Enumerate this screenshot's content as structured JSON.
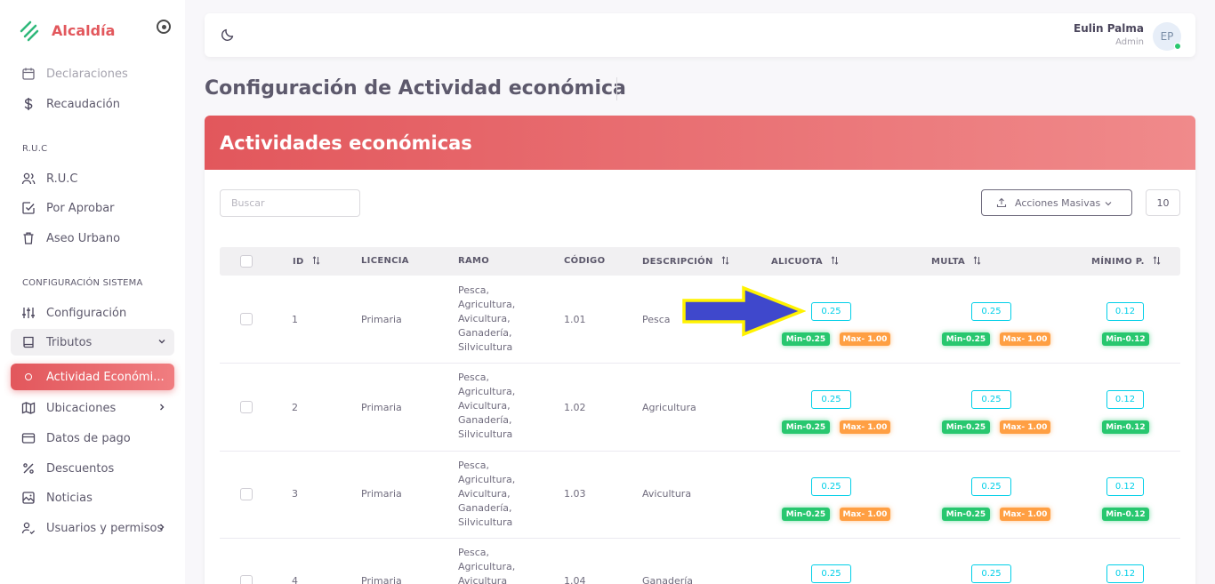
{
  "brand": {
    "name": "Alcaldía"
  },
  "sidebar": {
    "items_top": [
      {
        "label": "Declaraciones",
        "icon": "calendar-icon"
      },
      {
        "label": "Recaudación",
        "icon": "dollar-icon"
      }
    ],
    "section_ruc": "R.U.C",
    "items_ruc": [
      {
        "label": "R.U.C",
        "icon": "users-icon"
      },
      {
        "label": "Por Aprobar",
        "icon": "checkbox-icon"
      },
      {
        "label": "Aseo Urbano",
        "icon": "trash-icon"
      }
    ],
    "section_config": "CONFIGURACIÓN SISTEMA",
    "items_config": [
      {
        "label": "Configuración",
        "icon": "sliders-icon"
      },
      {
        "label": "Tributos",
        "icon": "book-icon"
      },
      {
        "label": "Actividad Económi...",
        "icon": "circle-icon"
      },
      {
        "label": "Ubicaciones",
        "icon": "map-icon"
      },
      {
        "label": "Datos de pago",
        "icon": "credit-card-icon"
      },
      {
        "label": "Descuentos",
        "icon": "percent-icon"
      },
      {
        "label": "Noticias",
        "icon": "photo-icon"
      },
      {
        "label": "Usuarios y permisos",
        "icon": "user-check-icon"
      }
    ]
  },
  "topbar": {
    "user_name": "Eulin Palma",
    "user_role": "Admin",
    "avatar_initials": "EP"
  },
  "page": {
    "title": "Configuración de Actividad económica"
  },
  "card": {
    "title": "Actividades económicas",
    "search_placeholder": "Buscar",
    "bulk_actions_label": "Acciones Masivas",
    "page_size": "10"
  },
  "table": {
    "columns": [
      "ID",
      "LICENCIA",
      "RAMO",
      "CÓDIGO",
      "DESCRIPCIÓN",
      "ALICUOTA",
      "MULTA",
      "MÍNIMO P."
    ],
    "rows": [
      {
        "id": "1",
        "licencia": "Primaria",
        "ramo": [
          "Pesca,",
          "Agricultura,",
          "Avicultura,",
          "Ganadería,",
          "Silvicultura"
        ],
        "codigo": "1.01",
        "descripcion": "Pesca",
        "alicuota": "0.25",
        "alicuota_min": "Min-0.25",
        "alicuota_max": "Max- 1.00",
        "multa": "0.25",
        "multa_min": "Min-0.25",
        "multa_max": "Max- 1.00",
        "minimo": "0.12",
        "minimo_min": "Min-0.12"
      },
      {
        "id": "2",
        "licencia": "Primaria",
        "ramo": [
          "Pesca,",
          "Agricultura,",
          "Avicultura,",
          "Ganadería,",
          "Silvicultura"
        ],
        "codigo": "1.02",
        "descripcion": "Agricultura",
        "alicuota": "0.25",
        "alicuota_min": "Min-0.25",
        "alicuota_max": "Max- 1.00",
        "multa": "0.25",
        "multa_min": "Min-0.25",
        "multa_max": "Max- 1.00",
        "minimo": "0.12",
        "minimo_min": "Min-0.12"
      },
      {
        "id": "3",
        "licencia": "Primaria",
        "ramo": [
          "Pesca,",
          "Agricultura,",
          "Avicultura,",
          "Ganadería,",
          "Silvicultura"
        ],
        "codigo": "1.03",
        "descripcion": "Avicultura",
        "alicuota": "0.25",
        "alicuota_min": "Min-0.25",
        "alicuota_max": "Max- 1.00",
        "multa": "0.25",
        "multa_min": "Min-0.25",
        "multa_max": "Max- 1.00",
        "minimo": "0.12",
        "minimo_min": "Min-0.12"
      },
      {
        "id": "4",
        "licencia": "Primaria",
        "ramo": [
          "Pesca,",
          "Agricultura,",
          "Avicultura"
        ],
        "codigo": "1.04",
        "descripcion": "Ganadería",
        "alicuota": "0.25",
        "multa": "0.25",
        "minimo": "0.12"
      }
    ]
  },
  "colors": {
    "accent": "#e2575c",
    "info": "#00cfe8",
    "success": "#28c76f",
    "warning": "#ff9f43",
    "annotation_arrow": "#3f48cc",
    "annotation_outline": "#fff200"
  }
}
